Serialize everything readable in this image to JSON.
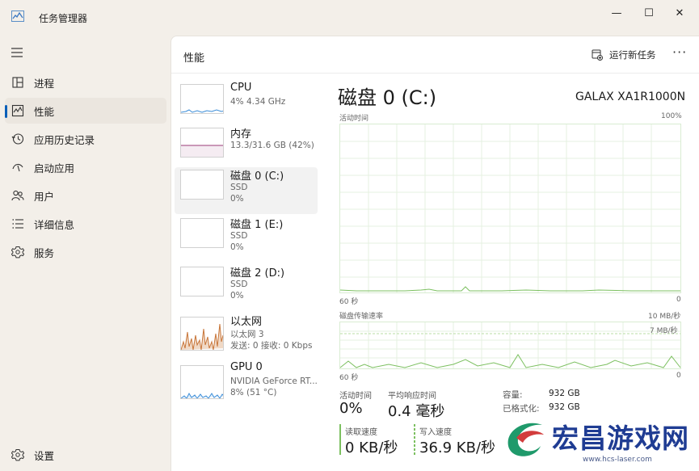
{
  "window": {
    "title": "任务管理器",
    "minimize_glyph": "—",
    "maximize_glyph": "☐",
    "close_glyph": "✕"
  },
  "nav": {
    "items": [
      {
        "label": "进程",
        "icon": "processes-icon"
      },
      {
        "label": "性能",
        "icon": "performance-icon",
        "active": true
      },
      {
        "label": "应用历史记录",
        "icon": "app-history-icon"
      },
      {
        "label": "启动应用",
        "icon": "startup-icon"
      },
      {
        "label": "用户",
        "icon": "users-icon"
      },
      {
        "label": "详细信息",
        "icon": "details-icon"
      },
      {
        "label": "服务",
        "icon": "services-icon"
      }
    ],
    "settings_label": "设置"
  },
  "header": {
    "title": "性能",
    "run_task_label": "运行新任务",
    "more_glyph": "···"
  },
  "devices": [
    {
      "name": "CPU",
      "lines": [
        "4% 4.34 GHz"
      ]
    },
    {
      "name": "内存",
      "lines": [
        "13.3/31.6 GB (42%)"
      ]
    },
    {
      "name": "磁盘 0 (C:)",
      "lines": [
        "SSD",
        "0%"
      ],
      "active": true
    },
    {
      "name": "磁盘 1 (E:)",
      "lines": [
        "SSD",
        "0%"
      ]
    },
    {
      "name": "磁盘 2 (D:)",
      "lines": [
        "SSD",
        "0%"
      ]
    },
    {
      "name": "以太网",
      "lines": [
        "以太网 3",
        "发送: 0 接收: 0 Kbps"
      ]
    },
    {
      "name": "GPU 0",
      "lines": [
        "NVIDIA GeForce RT...",
        "8% (51 °C)"
      ]
    }
  ],
  "detail": {
    "title": "磁盘 0 (C:)",
    "model": "GALAX XA1R1000N",
    "graph1": {
      "label": "活动时间",
      "max": "100%",
      "time_label": "60 秒",
      "min": "0"
    },
    "graph2": {
      "label": "磁盘传输速率",
      "max": "10 MB/秒",
      "sub_max": "7 MB/秒",
      "time_label": "60 秒",
      "min": "0"
    },
    "stats": {
      "active_time_label": "活动时间",
      "active_time_value": "0%",
      "avg_response_label": "平均响应时间",
      "avg_response_value": "0.4 毫秒",
      "read_label": "读取速度",
      "read_value": "0 KB/秒",
      "write_label": "写入速度",
      "write_value": "36.9 KB/秒"
    },
    "info": {
      "capacity_label": "容量:",
      "capacity_value": "932 GB",
      "formatted_label": "已格式化:",
      "formatted_value": "932 GB"
    }
  },
  "watermark": {
    "text": "宏昌游戏网",
    "url": "www.hcs-laser.com"
  },
  "colors": {
    "accent": "#0a5fb8",
    "cpu_line": "#3b8dd8",
    "memory_line": "#9b3b78",
    "disk_line": "#7cc060",
    "ethernet_line": "#c8763a",
    "gpu_line": "#3b8dd8"
  }
}
